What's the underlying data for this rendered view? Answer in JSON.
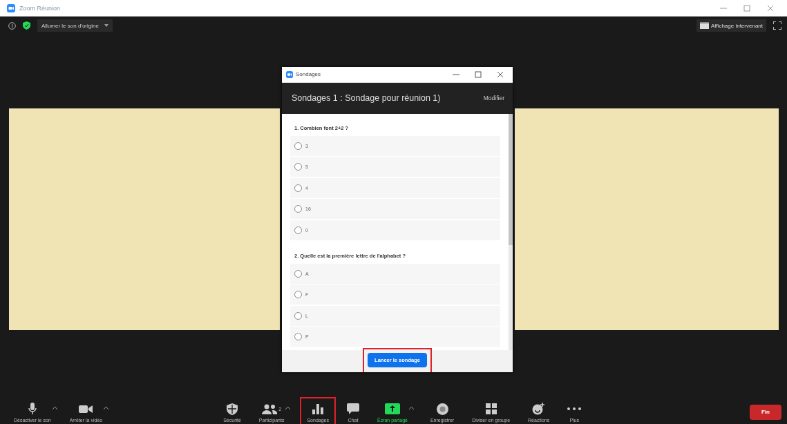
{
  "window": {
    "title": "Zoom Réunion"
  },
  "top_bar": {
    "audio_button": "Allumer le son d'origine",
    "view_button": "Affichage intervenant"
  },
  "poll_window": {
    "title": "Sondages",
    "heading": "Sondages 1 : Sondage pour réunion 1)",
    "edit_link": "Modifier",
    "questions": [
      {
        "text": "1. Combien font 2+2 ?",
        "options": [
          {
            "label": "3",
            "selected": false
          },
          {
            "label": "5",
            "selected": false
          },
          {
            "label": "4",
            "selected": false
          },
          {
            "label": "16",
            "selected": false
          },
          {
            "label": "0",
            "selected": false
          }
        ]
      },
      {
        "text": "2. Quelle est la première lettre de l'alphabet ?",
        "options": [
          {
            "label": "A",
            "selected": false
          },
          {
            "label": "F",
            "selected": false
          },
          {
            "label": "L",
            "selected": false
          },
          {
            "label": "P",
            "selected": false
          }
        ]
      }
    ],
    "launch_button": "Lancer le sondage",
    "launch_highlighted": true
  },
  "toolbar": {
    "left": [
      {
        "kind": "mic",
        "label": "Désactiver le son",
        "active": false,
        "highlighted": false
      },
      {
        "kind": "video",
        "label": "Arrêter la vidéo",
        "active": false,
        "highlighted": false
      }
    ],
    "center": [
      {
        "kind": "security",
        "label": "Sécurité",
        "active": false,
        "highlighted": false
      },
      {
        "kind": "participants",
        "label": "Participants",
        "count": "2",
        "active": false,
        "highlighted": false
      },
      {
        "kind": "polls",
        "label": "Sondages",
        "active": false,
        "highlighted": true
      },
      {
        "kind": "chat",
        "label": "Chat",
        "active": false,
        "highlighted": false
      },
      {
        "kind": "share",
        "label": "Écran partagé",
        "active": true,
        "highlighted": false
      },
      {
        "kind": "record",
        "label": "Enregistrer",
        "active": false,
        "highlighted": false
      },
      {
        "kind": "breakout",
        "label": "Diviser en groupe",
        "active": false,
        "highlighted": false
      },
      {
        "kind": "reactions",
        "label": "Réactions",
        "active": false,
        "highlighted": false
      },
      {
        "kind": "more",
        "label": "Plus",
        "active": false,
        "highlighted": false
      }
    ],
    "end_button": "Fin"
  }
}
